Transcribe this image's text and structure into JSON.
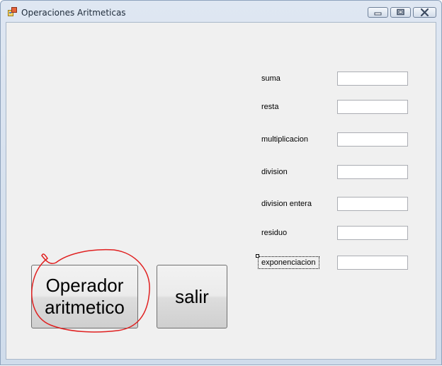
{
  "window": {
    "title": "Operaciones Aritmeticas",
    "controls": [
      "minimize",
      "maximize",
      "close"
    ]
  },
  "form": {
    "fields": [
      {
        "label": "suma",
        "value": ""
      },
      {
        "label": "resta",
        "value": ""
      },
      {
        "label": "multiplicacion",
        "value": ""
      },
      {
        "label": "division",
        "value": ""
      },
      {
        "label": "division entera",
        "value": ""
      },
      {
        "label": "residuo",
        "value": ""
      },
      {
        "label": "exponenciacion",
        "value": ""
      }
    ],
    "buttons": {
      "operador_line1": "Operador",
      "operador_line2": "aritmetico",
      "salir": "salir"
    }
  },
  "colors": {
    "form_background": "#f0f0f0",
    "annotation_circle": "#e02020"
  },
  "icons": [
    "app-icon",
    "minimize-icon",
    "maximize-icon",
    "close-icon"
  ]
}
